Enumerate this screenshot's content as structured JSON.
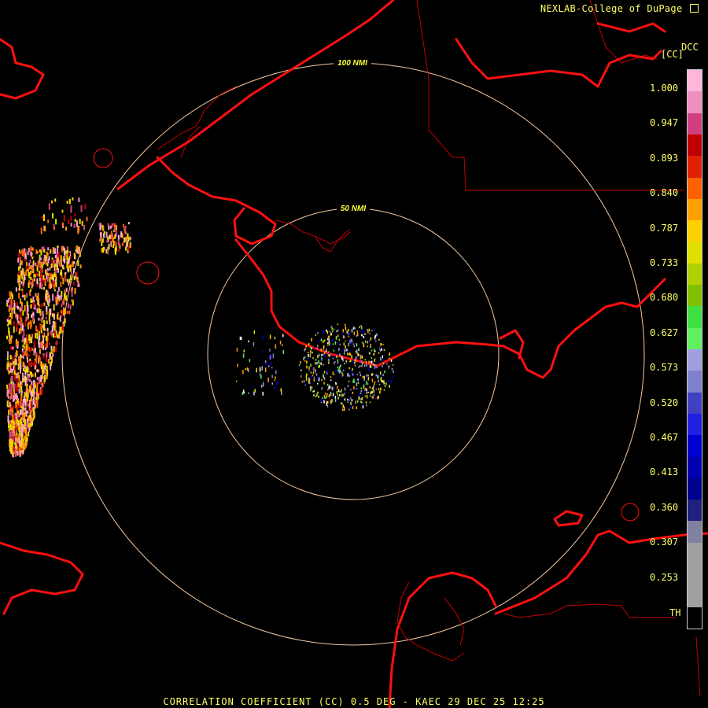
{
  "credit": "NEXLAB-College of DuPage",
  "credit_icon": "external-link-icon",
  "product_code": "DCC",
  "unit_label": "[CC]",
  "legend": {
    "ticks": [
      "1.000",
      "0.947",
      "0.893",
      "0.840",
      "0.787",
      "0.733",
      "0.680",
      "0.627",
      "0.573",
      "0.520",
      "0.467",
      "0.413",
      "0.360",
      "0.307",
      "0.253"
    ],
    "th_label": "TH",
    "colors": [
      "#ffb6d9",
      "#f090c0",
      "#d04080",
      "#c00000",
      "#e02000",
      "#ff6000",
      "#ffa000",
      "#ffd000",
      "#e0e000",
      "#b0d000",
      "#80c000",
      "#40e040",
      "#60f060",
      "#a0a0e0",
      "#8080d0",
      "#4040c0",
      "#2020e0",
      "#0000d0",
      "#0000b0",
      "#000090",
      "#202080",
      "#8080a0",
      "#a0a0a0",
      "#a0a0a0",
      "#a0a0a0",
      "#000000"
    ]
  },
  "range_rings": [
    "50 NMI",
    "100 NMI"
  ],
  "footer": "CORRELATION COEFFICIENT (CC) 0.5 DEG - KAEC 29 DEC 25 12:25"
}
